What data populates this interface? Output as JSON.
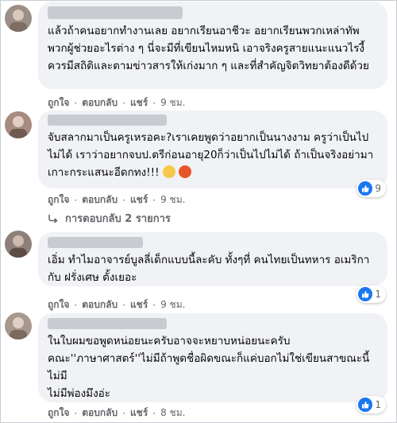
{
  "comments": [
    {
      "text": "แล้วถ้าคนอยากทำงานเลย อยากเรียนอาชีวะ อยากเรียนพวกเหล่าทัพ พวกผู้ช่วยอะไรต่าง ๆ นี่จะมีที่เขียนไหมหนิ เอาจริงครูสายแนะแนวไรงี้ควรมีสถิติและตามข่าวสารให้เก่งมาก ๆ และที่สำคัญจิตวิทยาต้องดีด้วย",
      "like_label": "ถูกใจ",
      "reply_label": "ตอบกลับ",
      "share_label": "แชร์",
      "time": "9 ชม."
    },
    {
      "text": "จับสลากมาเป็นครูเหรอคะ?เราเคยพูดว่าอยากเป็นนางงาม ครูว่าเป็นไปไม่ได้ เราว่าอยากจบป.ตรีก่อนอายุ20ก็ว่าเป็นไปไม่ได้ ถ้าเป็นจริงอย่ามาเกาะกระแสนะอีดกทง!!!",
      "like_label": "ถูกใจ",
      "reply_label": "ตอบกลับ",
      "share_label": "แชร์",
      "time": "9 ชม.",
      "reactions": "9",
      "replies_label": "การตอบกลับ 2 รายการ"
    },
    {
      "text": "เอิ่ม ทำไมอาจารย์บูลลี่เด็กแบบนี้ละคับ ทั้งๆที่ คนไทยเป็นทหาร อเมริกา กับ ฝรั่งเศษ ตั้งเยอะ",
      "like_label": "ถูกใจ",
      "reply_label": "ตอบกลับ",
      "share_label": "แชร์",
      "time": "9 ชม.",
      "reactions": "1"
    },
    {
      "text": "ในใบผมขอพูดหน่อยนะครับอาจจะหยาบหน่อยนะครับ คณะ''ภาษาศาสตร์''ไม่มีถ้าพูดชื่อผิดขณะก็แค่บอกไม่ใช่เขียนสาขณะนี้ไม่มี\nไม่มีพ่องมึงอ่ะ",
      "like_label": "ถูกใจ",
      "reply_label": "ตอบกลับ",
      "share_label": "แชร์",
      "time": "8 ชม.",
      "reactions": "1"
    }
  ]
}
